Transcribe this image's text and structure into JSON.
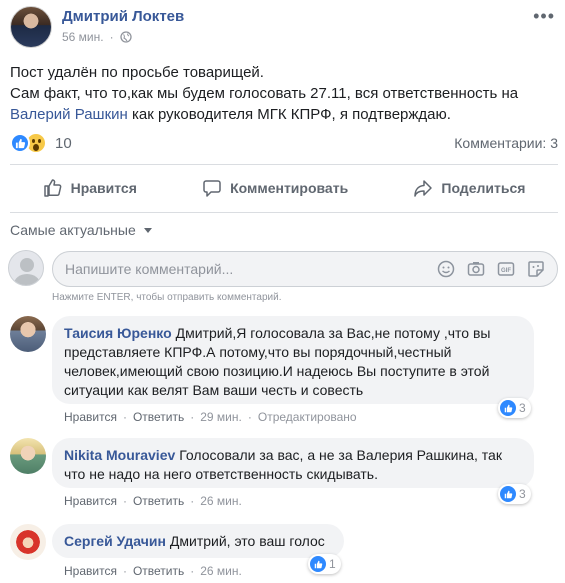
{
  "post": {
    "author": "Дмитрий Локтев",
    "time": "56 мин.",
    "dot": "·",
    "line1": "Пост удалён по просьбе товарищей.",
    "line2_before": "Сам факт, что то,как мы будем голосовать 27.11, вся ответственность на",
    "mention": "Валерий Рашкин",
    "line3_after": " как руководителя МГК КПРФ, я подтверждаю.",
    "reactions_count": "10",
    "comments_label": "Комментарии: 3"
  },
  "actions": {
    "like": "Нравится",
    "comment": "Комментировать",
    "share": "Поделиться"
  },
  "sort": {
    "label": "Самые актуальные"
  },
  "composer": {
    "placeholder": "Напишите комментарий...",
    "hint": "Нажмите ENTER, чтобы отправить комментарий."
  },
  "comments": [
    {
      "author": "Таисия Юренко",
      "text": "Дмитрий,Я голосовала за Вас,не потому ,что вы представляете КПРФ.А потому,что вы порядочный,честный человек,имеющий свою позицию.И надеюсь Вы поступите в этой ситуации как велят Вам ваши честь и совесть",
      "like": "Нравится",
      "reply": "Ответить",
      "time": "29 мин.",
      "edited": "Отредактировано",
      "likes": "3"
    },
    {
      "author": "Nikita Mouraviev",
      "text": "Голосовали за вас, а не за Валерия Рашкина, так что не надо на него ответственность скидывать.",
      "like": "Нравится",
      "reply": "Ответить",
      "time": "26 мин.",
      "likes": "3"
    },
    {
      "author": "Сергей Удачин",
      "text": "Дмитрий, это ваш голос",
      "like": "Нравится",
      "reply": "Ответить",
      "time": "26 мин.",
      "likes": "1"
    }
  ],
  "colors": {
    "link": "#385898",
    "like_blue": "#2e89ff",
    "bubble_bg": "#f2f3f5",
    "muted": "#90949c"
  }
}
